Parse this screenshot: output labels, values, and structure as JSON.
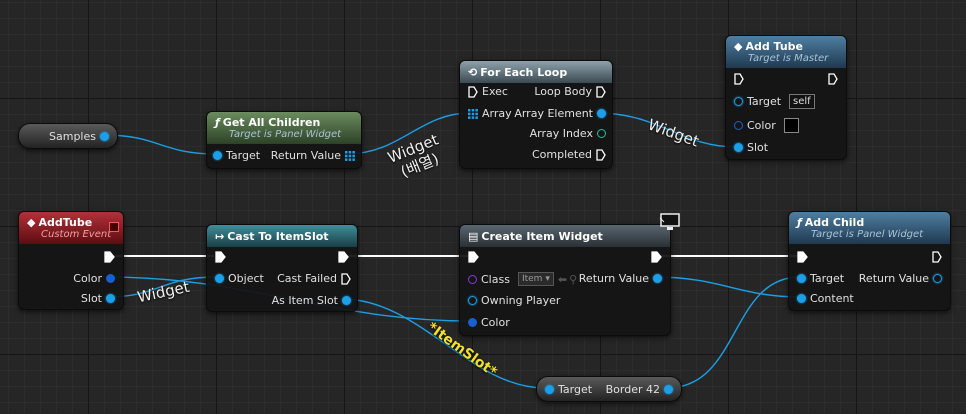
{
  "wire_labels": {
    "widget_array_l1": "Widget",
    "widget_array_l2": "(배열)",
    "widget_top": "Widget",
    "widget_bottom": "Widget",
    "item_slot": "*ItemSlot*"
  },
  "samples": {
    "label": "Samples"
  },
  "get_all_children": {
    "title": "Get All Children",
    "subtitle": "Target is Panel Widget",
    "target": "Target",
    "return_value": "Return Value"
  },
  "for_each_loop": {
    "title": "For Each Loop",
    "exec": "Exec",
    "loop_body": "Loop Body",
    "array": "Array",
    "array_element": "Array Element",
    "array_index": "Array Index",
    "completed": "Completed"
  },
  "add_tube_call": {
    "title": "Add Tube",
    "subtitle": "Target is Master",
    "target": "Target",
    "target_value": "self",
    "color": "Color",
    "slot": "Slot"
  },
  "add_tube_event": {
    "title": "AddTube",
    "subtitle": "Custom Event",
    "color": "Color",
    "slot": "Slot"
  },
  "cast_to_item_slot": {
    "title": "Cast To ItemSlot",
    "object": "Object",
    "cast_failed": "Cast Failed",
    "as_item_slot": "As Item Slot"
  },
  "create_item_widget": {
    "title": "Create Item Widget",
    "class": "Class",
    "class_value": "Item",
    "return_value": "Return Value",
    "owning_player": "Owning Player",
    "color": "Color"
  },
  "add_child": {
    "title": "Add Child",
    "subtitle": "Target is Panel Widget",
    "target": "Target",
    "return_value": "Return Value",
    "content": "Content"
  },
  "border_getter": {
    "target": "Target",
    "output": "Border 42"
  },
  "colors": {
    "object_pin": "#1a9fe8",
    "exec_wire": "#ffffff",
    "label_highlight": "#f0e02a"
  }
}
